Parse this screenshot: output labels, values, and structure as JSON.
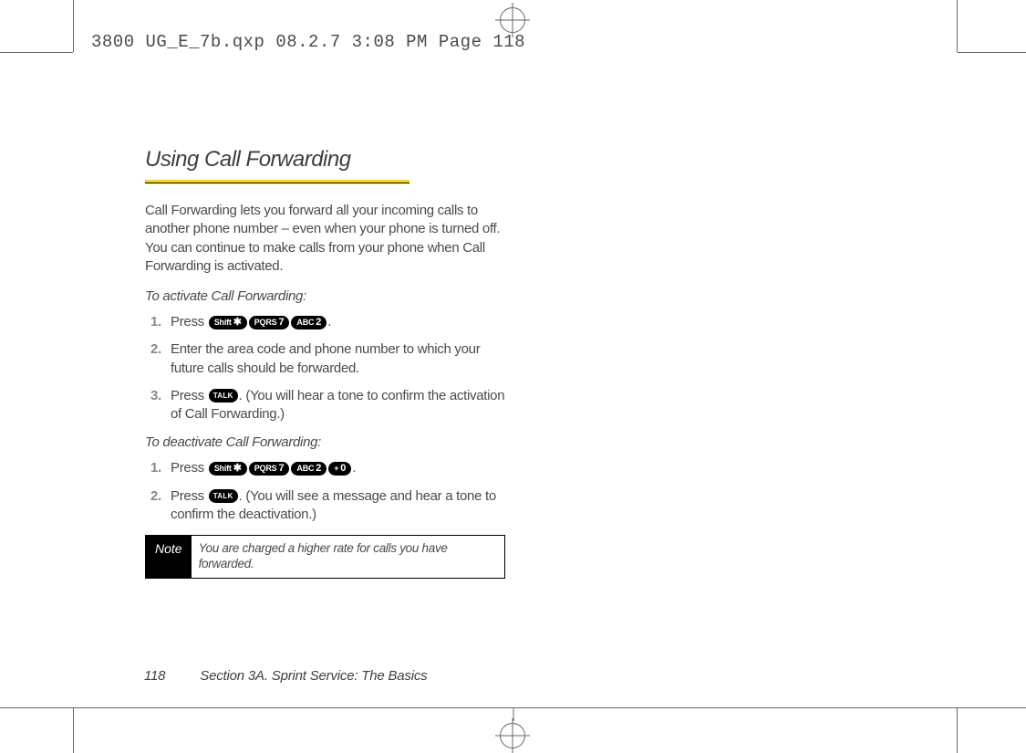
{
  "slug": "3800 UG_E_7b.qxp  08.2.7  3:08 PM  Page 118",
  "heading": "Using Call Forwarding",
  "intro": "Call Forwarding lets you forward all your incoming calls to another phone number – even when your phone is turned off. You can continue to make calls from your phone when Call Forwarding is activated.",
  "activate": {
    "subhead": "To activate Call Forwarding:",
    "steps": [
      {
        "num": "1.",
        "pre": "Press ",
        "keys": [
          "shift-star",
          "pqrs-7",
          "abc-2"
        ],
        "post": "."
      },
      {
        "num": "2.",
        "text": "Enter the area code and phone number to which your future calls should be forwarded."
      },
      {
        "num": "3.",
        "pre": "Press ",
        "keys": [
          "talk"
        ],
        "post": ". (You will hear a tone to confirm the activation of Call Forwarding.)"
      }
    ]
  },
  "deactivate": {
    "subhead": "To deactivate Call Forwarding:",
    "steps": [
      {
        "num": "1.",
        "pre": "Press ",
        "keys": [
          "shift-star",
          "pqrs-7",
          "abc-2",
          "plus-0"
        ],
        "post": "."
      },
      {
        "num": "2.",
        "pre": "Press ",
        "keys": [
          "talk"
        ],
        "post": ". (You will see a message and hear a tone to confirm the deactivation.)"
      }
    ]
  },
  "note": {
    "label": "Note",
    "text": "You are charged a higher rate for calls you have forwarded."
  },
  "footer": {
    "page": "118",
    "section": "Section 3A. Sprint Service: The Basics"
  },
  "keys": {
    "shift-star": {
      "small": "Shift",
      "big": "✱"
    },
    "pqrs-7": {
      "small": "PQRS",
      "big": "7"
    },
    "abc-2": {
      "small": "ABC",
      "big": "2"
    },
    "plus-0": {
      "small": "+",
      "big": "0"
    },
    "talk": {
      "label": "TALK"
    }
  }
}
